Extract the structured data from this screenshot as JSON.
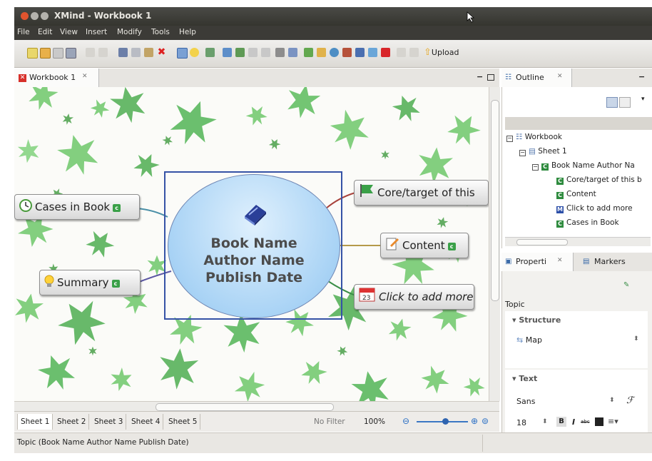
{
  "window": {
    "title": "XMind - Workbook 1"
  },
  "menu": [
    "File",
    "Edit",
    "View",
    "Insert",
    "Modify",
    "Tools",
    "Help"
  ],
  "toolbar": {
    "upload_label": "Upload"
  },
  "editor": {
    "tab_label": "Workbook 1"
  },
  "map": {
    "central": {
      "line1": "Book Name",
      "line2": "Author Name",
      "line3": "Publish Date"
    },
    "topics": {
      "cases": "Cases in Book",
      "summary": "Summary",
      "core": "Core/target of this",
      "content": "Content",
      "click": "Click to add more"
    },
    "tag_letter": "c"
  },
  "sheets": [
    "Sheet 1",
    "Sheet 2",
    "Sheet 3",
    "Sheet 4",
    "Sheet 5"
  ],
  "editor_status": {
    "filter": "No Filter",
    "zoom": "100%",
    "zoom_level": 0.55
  },
  "outline": {
    "tab_label": "Outline",
    "items": [
      {
        "label": "Workbook",
        "icon": "workbook-icon"
      },
      {
        "label": "Sheet 1",
        "icon": "sheet-icon"
      },
      {
        "label": "Book Name Author Na",
        "icon": "central-topic-icon"
      },
      {
        "label": "Core/target of this b",
        "icon": "topic-icon"
      },
      {
        "label": "Content",
        "icon": "topic-icon"
      },
      {
        "label": "Click to add more",
        "icon": "topic-icon"
      },
      {
        "label": "Cases in Book",
        "icon": "topic-icon"
      }
    ]
  },
  "properties": {
    "tab_label": "Properti",
    "markers_tab_label": "Markers",
    "section_label": "Topic",
    "structure_head": "Structure",
    "structure_value": "Map",
    "text_head": "Text",
    "font_value": "Sans",
    "size_value": "18",
    "bold_label": "B",
    "italic_label": "I",
    "strike_label": "abc"
  },
  "statusbar": {
    "text": "Topic (Book Name Author Name Publish Date)"
  },
  "colors": {
    "central_border": "#3552a6",
    "central_fill": "#a9d3f5",
    "leaf_green": "#5dbb5e",
    "tag_green": "#3aa048"
  }
}
